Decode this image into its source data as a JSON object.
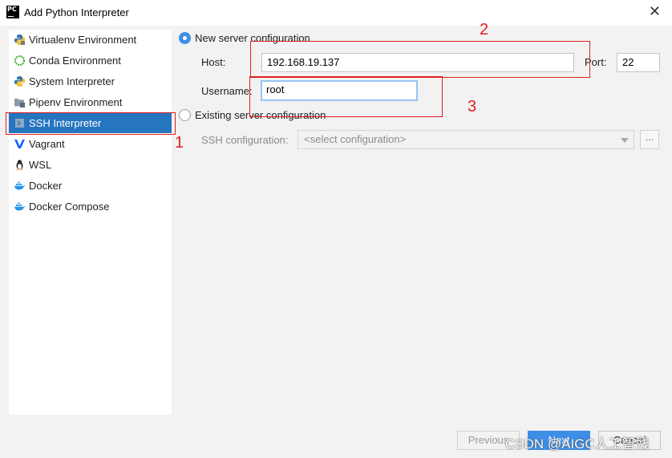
{
  "window": {
    "app_icon_text": "PC",
    "title": "Add Python Interpreter",
    "close_glyph": "✕"
  },
  "sidebar": {
    "items": [
      {
        "label": "Virtualenv Environment",
        "icon": "virtualenv-python-icon"
      },
      {
        "label": "Conda Environment",
        "icon": "conda-ring-icon"
      },
      {
        "label": "System Interpreter",
        "icon": "python-icon"
      },
      {
        "label": "Pipenv Environment",
        "icon": "pipenv-folder-icon"
      },
      {
        "label": "SSH Interpreter",
        "icon": "ssh-terminal-icon",
        "selected": true
      },
      {
        "label": "Vagrant",
        "icon": "vagrant-v-icon"
      },
      {
        "label": "WSL",
        "icon": "linux-penguin-icon"
      },
      {
        "label": "Docker",
        "icon": "docker-whale-icon"
      },
      {
        "label": "Docker Compose",
        "icon": "docker-compose-icon"
      }
    ]
  },
  "form": {
    "new_server_label": "New server configuration",
    "new_server_selected": true,
    "host_label": "Host:",
    "host_value": "192.168.19.137",
    "port_label": "Port:",
    "port_value": "22",
    "username_label": "Username:",
    "username_value": "root",
    "existing_server_label": "Existing server configuration",
    "ssh_config_label": "SSH configuration:",
    "ssh_config_placeholder": "<select configuration>",
    "browse_label": "..."
  },
  "annotations": {
    "n1": "1",
    "n2": "2",
    "n3": "3",
    "color": "#e02020"
  },
  "footer": {
    "previous_label": "Previous",
    "next_label": "Next",
    "cancel_label": "Cancel"
  },
  "watermark": "CSDN @AIGC人工智残",
  "colors": {
    "selection": "#2675bf",
    "primary_button": "#3d8ee6",
    "focus_ring": "#97c3f3"
  }
}
